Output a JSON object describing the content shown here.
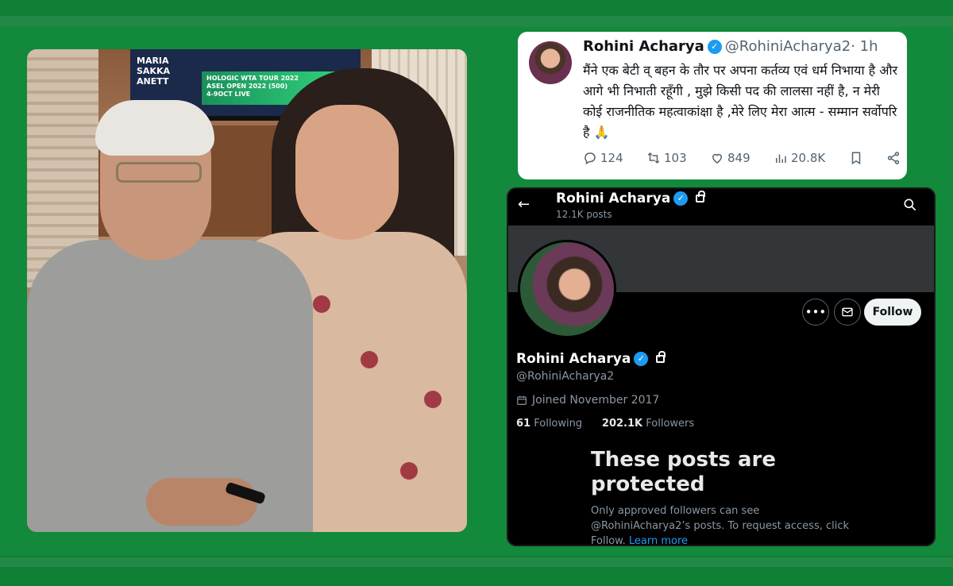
{
  "tweet": {
    "name": "Rohini Acharya",
    "handle": "@RohiniAcharya2",
    "time": "· 1h",
    "text": "मैंने एक बेटी व् बहन के तौर पर अपना कर्तव्य एवं धर्म निभाया है और आगे भी निभाती रहूँगी , मुझे किसी पद की लालसा नहीं है, न मेरी कोई राजनीतिक महत्वाकांक्षा है ,मेरे लिए मेरा आत्म - सम्मान सर्वोपरि है 🙏",
    "replies": "124",
    "reposts": "103",
    "likes": "849",
    "views": "20.8K"
  },
  "profile": {
    "top_name": "Rohini Acharya",
    "posts_count": "12.1K posts",
    "follow_label": "Follow",
    "name": "Rohini Acharya",
    "handle": "@RohiniAcharya2",
    "joined": "Joined November 2017",
    "following_count": "61",
    "following_label": "Following",
    "followers_count": "202.1K",
    "followers_label": "Followers",
    "protected_title": "These posts are protected",
    "protected_desc": "Only approved followers can see @RohiniAcharya2’s posts. To request access, click Follow.",
    "learn_more": "Learn more"
  },
  "photo": {
    "tv_scoreline": "MARIA\nSAKKA\nANETT",
    "tv_banner": "HOLOGIC WTA TOUR 2022\nASEL OPEN 2022 (500)\n4-9OCT LIVE"
  },
  "colors": {
    "background_green": "#12893b",
    "x_blue": "#1d9bf0"
  }
}
